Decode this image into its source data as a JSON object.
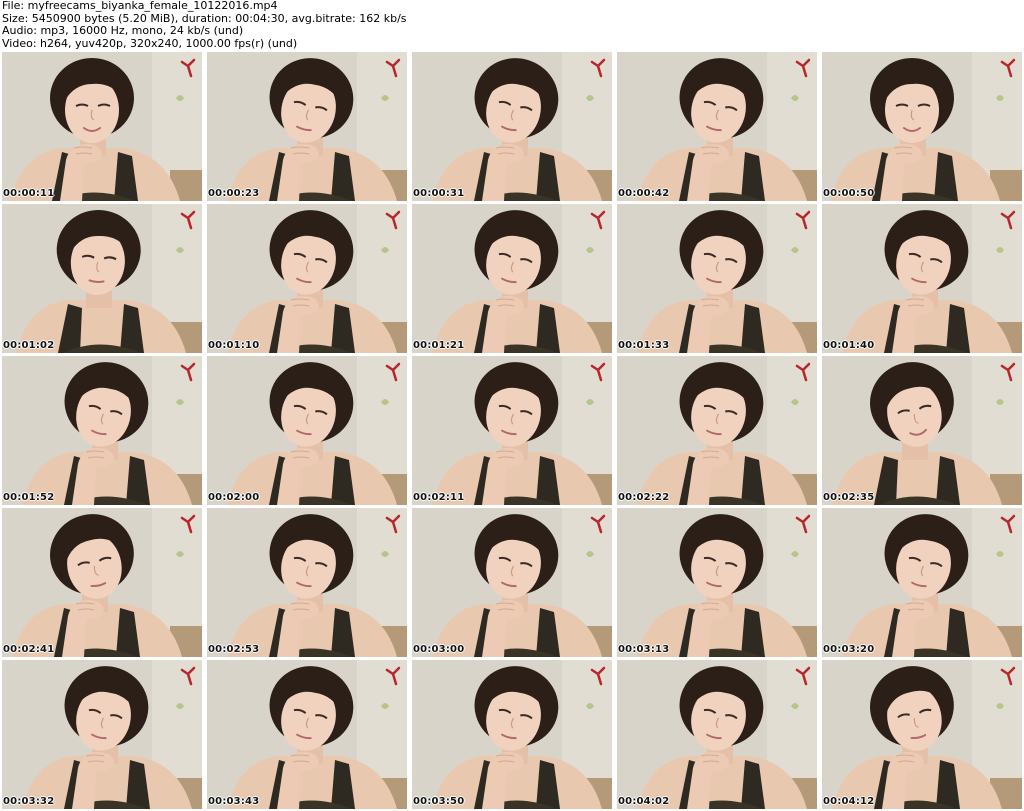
{
  "header": {
    "file_line": "File: myfreecams_biyanka_female_10122016.mp4",
    "size_line": "Size: 5450900 bytes (5.20 MiB), duration: 00:04:30, avg.bitrate: 162 kb/s",
    "audio_line": "Audio: mp3, 16000 Hz, mono, 24 kb/s (und)",
    "video_line": "Video: h264, yuv420p, 320x240, 1000.00 fps(r) (und)"
  },
  "thumbnails": [
    {
      "timestamp": "00:00:11",
      "pose": "smile-hand"
    },
    {
      "timestamp": "00:00:23",
      "pose": "lean"
    },
    {
      "timestamp": "00:00:31",
      "pose": "lean"
    },
    {
      "timestamp": "00:00:42",
      "pose": "lean"
    },
    {
      "timestamp": "00:00:50",
      "pose": "smile-hand"
    },
    {
      "timestamp": "00:01:02",
      "pose": "down"
    },
    {
      "timestamp": "00:01:10",
      "pose": "lean"
    },
    {
      "timestamp": "00:01:21",
      "pose": "lean"
    },
    {
      "timestamp": "00:01:33",
      "pose": "lean"
    },
    {
      "timestamp": "00:01:40",
      "pose": "lean"
    },
    {
      "timestamp": "00:01:52",
      "pose": "lean"
    },
    {
      "timestamp": "00:02:00",
      "pose": "lean"
    },
    {
      "timestamp": "00:02:11",
      "pose": "lean"
    },
    {
      "timestamp": "00:02:22",
      "pose": "lean"
    },
    {
      "timestamp": "00:02:35",
      "pose": "tilt"
    },
    {
      "timestamp": "00:02:41",
      "pose": "tilt-hand"
    },
    {
      "timestamp": "00:02:53",
      "pose": "lean"
    },
    {
      "timestamp": "00:03:00",
      "pose": "lean"
    },
    {
      "timestamp": "00:03:13",
      "pose": "lean"
    },
    {
      "timestamp": "00:03:20",
      "pose": "lean"
    },
    {
      "timestamp": "00:03:32",
      "pose": "lean"
    },
    {
      "timestamp": "00:03:43",
      "pose": "lean"
    },
    {
      "timestamp": "00:03:50",
      "pose": "lean"
    },
    {
      "timestamp": "00:04:02",
      "pose": "lean"
    },
    {
      "timestamp": "00:04:12",
      "pose": "tilt-hand"
    }
  ]
}
